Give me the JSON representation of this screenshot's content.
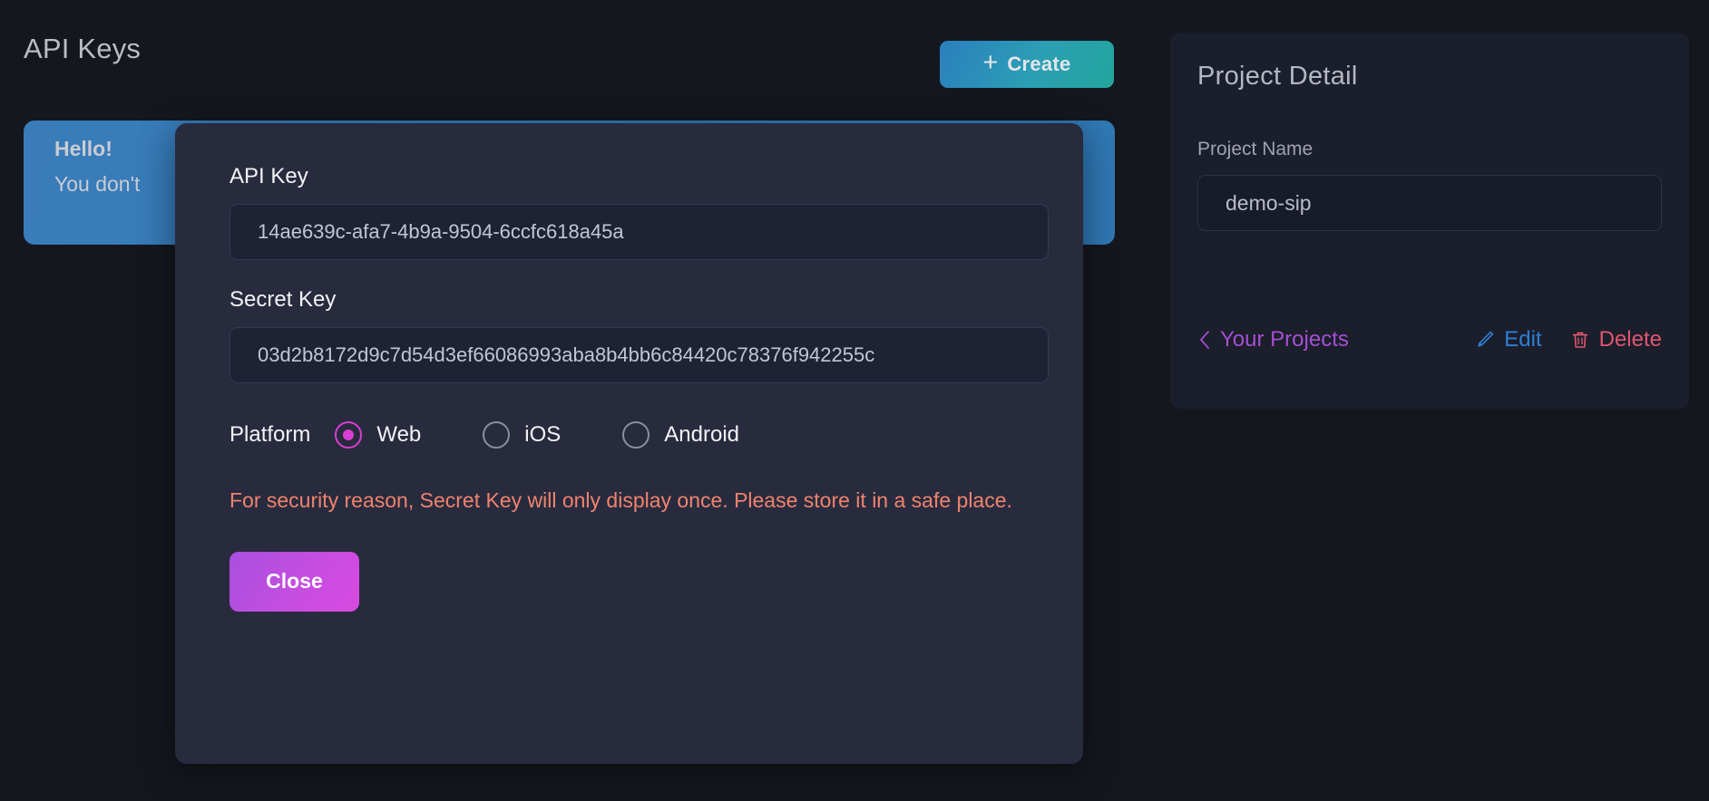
{
  "page": {
    "title": "API Keys",
    "background_color": "#15171f"
  },
  "toolbar": {
    "create_label": "Create",
    "create_icon": "plus-icon",
    "create_gradient_from": "#2b7fbe",
    "create_gradient_to": "#23a59c"
  },
  "alert": {
    "title": "Hello!",
    "text": "You don't",
    "background_color": "#2f78b4"
  },
  "modal": {
    "background_color": "#282b3e",
    "api_key": {
      "label": "API Key",
      "value": "14ae639c-afa7-4b9a-9504-6ccfc618a45a"
    },
    "secret_key": {
      "label": "Secret Key",
      "value": "03d2b8172d9c7d54d3ef66086993aba8b4bb6c84420c78376f942255c"
    },
    "platform": {
      "label": "Platform",
      "selected": "Web",
      "accent_color": "#d63fd1",
      "options": [
        {
          "label": "Web",
          "selected": true
        },
        {
          "label": "iOS",
          "selected": false
        },
        {
          "label": "Android",
          "selected": false
        }
      ]
    },
    "warning": {
      "text": "For security reason, Secret Key will only display once. Please store it in a safe place.",
      "color": "#f0836c"
    },
    "close_label": "Close",
    "close_gradient_from": "#a74fe0",
    "close_gradient_to": "#d94ae0"
  },
  "project_detail": {
    "title": "Project Detail",
    "name_label": "Project Name",
    "name_value": "demo-sip",
    "actions": [
      {
        "label": "Your Projects",
        "icon": "chevron-left-icon",
        "color": "#a54fd2"
      },
      {
        "label": "Edit",
        "icon": "pencil-icon",
        "color": "#2d7fd6"
      },
      {
        "label": "Delete",
        "icon": "trash-icon",
        "color": "#e0566f"
      }
    ]
  }
}
